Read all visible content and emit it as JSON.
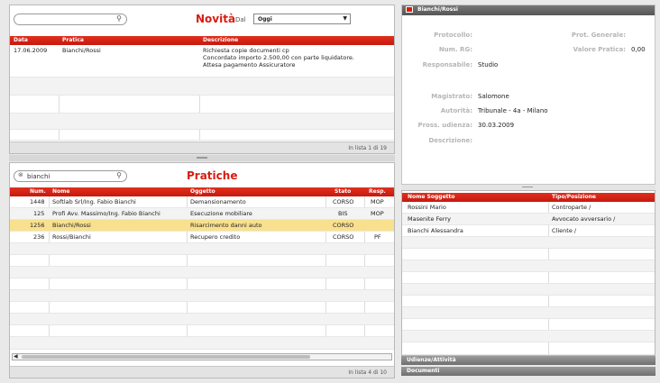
{
  "novita": {
    "search_value": "",
    "title": "Novità",
    "dal_label": "Dal",
    "period": "Oggi",
    "columns": [
      "Data",
      "Pratica",
      "Descrizione"
    ],
    "rows": [
      {
        "data": "17.06.2009",
        "pratica": "Bianchi/Rossi",
        "desc": [
          "Richiesta copie documenti cp",
          "Concordato importo 2.500,00 con parte liquidatore.",
          "Attesa pagamento Assicuratore"
        ]
      }
    ],
    "footer": "In lista 1 di 19"
  },
  "pratiche": {
    "search_value": "bianchi",
    "title": "Pratiche",
    "columns": [
      "Num.",
      "Nome",
      "Oggetto",
      "Stato",
      "Resp."
    ],
    "rows": [
      {
        "num": "1448",
        "nome": "Softlab Srl/Ing. Fabio Bianchi",
        "oggetto": "Demansionamento",
        "stato": "CORSO",
        "resp": "MOP"
      },
      {
        "num": "125",
        "nome": "Profi Avv. Massimo/Ing. Fabio Bianchi",
        "oggetto": "Esecuzione mobiliare",
        "stato": "BIS",
        "resp": "MOP"
      },
      {
        "num": "1256",
        "nome": "Bianchi/Rossi",
        "oggetto": "Risarcimento danni auto",
        "stato": "CORSO",
        "resp": ""
      },
      {
        "num": "236",
        "nome": "Rossi/Bianchi",
        "oggetto": "Recupero credito",
        "stato": "CORSO",
        "resp": "PF"
      }
    ],
    "footer": "In lista 4 di 10"
  },
  "detail": {
    "header": "Bianchi/Rossi",
    "fields": {
      "protocollo": {
        "k": "Protocollo:",
        "v": ""
      },
      "prot_generale": {
        "k": "Prot. Generale:",
        "v": ""
      },
      "num_rg": {
        "k": "Num. RG:",
        "v": ""
      },
      "valore_pratica": {
        "k": "Valore Pratica:",
        "v": "0,00"
      },
      "responsabile": {
        "k": "Responsabile:",
        "v": "Studio"
      },
      "magistrato": {
        "k": "Magistrato:",
        "v": "Salomone"
      },
      "autorita": {
        "k": "Autorità:",
        "v": "Tribunale - 4a - Milano"
      },
      "pross_udienza": {
        "k": "Pross. udienza:",
        "v": "30.03.2009"
      },
      "descrizione": {
        "k": "Descrizione:",
        "v": ""
      }
    }
  },
  "soggetti": {
    "columns": [
      "Nome Soggetto",
      "Tipo/Posizione"
    ],
    "rows": [
      {
        "nome": "Rossini Mario",
        "tipo": "Controparte /"
      },
      {
        "nome": "Masenite Ferry",
        "tipo": "Avvocato avversario /"
      },
      {
        "nome": "Bianchi Alessandra",
        "tipo": "Cliente /"
      }
    ]
  },
  "bottom_tabs": [
    "Udienze/Attività",
    "Documenti"
  ],
  "colors": {
    "accent": "#d81d12",
    "header_red": "#e0301e",
    "selected_row": "#f9e08e"
  }
}
